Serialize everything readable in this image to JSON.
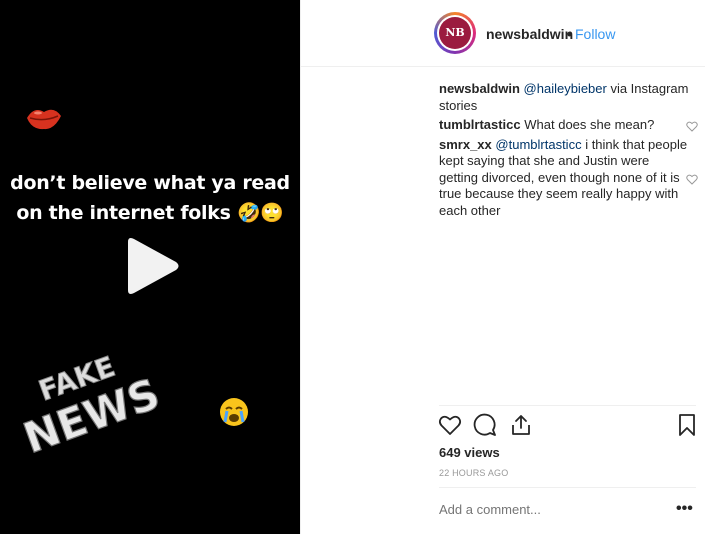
{
  "media": {
    "caption_line1": "don’t believe what ya read",
    "caption_line2": "on the internet folks",
    "caption_emojis": "🤣🙄",
    "sticker_text_top": "FAKE",
    "sticker_text_bottom": "NEWS",
    "background_color": "#000000"
  },
  "header": {
    "avatar_text": "NB",
    "username": "newsbaldwin",
    "separator": "•",
    "follow_label": "Follow"
  },
  "comments": [
    {
      "username": "newsbaldwin",
      "mention": "@haileybieber",
      "text": " via Instagram stories",
      "has_like": false
    },
    {
      "username": "tumblrtasticc",
      "mention": "",
      "text": "What does she mean?",
      "has_like": true
    },
    {
      "username": "smrx_xx",
      "mention": "@tumblrtasticc",
      "text": " i think that people kept saying that she and Justin were getting divorced, even though none of it is true because they seem really happy with each other",
      "has_like": true
    }
  ],
  "actions": {
    "views": "649 views",
    "timestamp": "22 HOURS AGO",
    "add_comment_placeholder": "Add a comment...",
    "more_label": "•••"
  },
  "colors": {
    "link": "#3897f0",
    "mention": "#003569",
    "muted": "#999999",
    "border": "#efefef"
  }
}
